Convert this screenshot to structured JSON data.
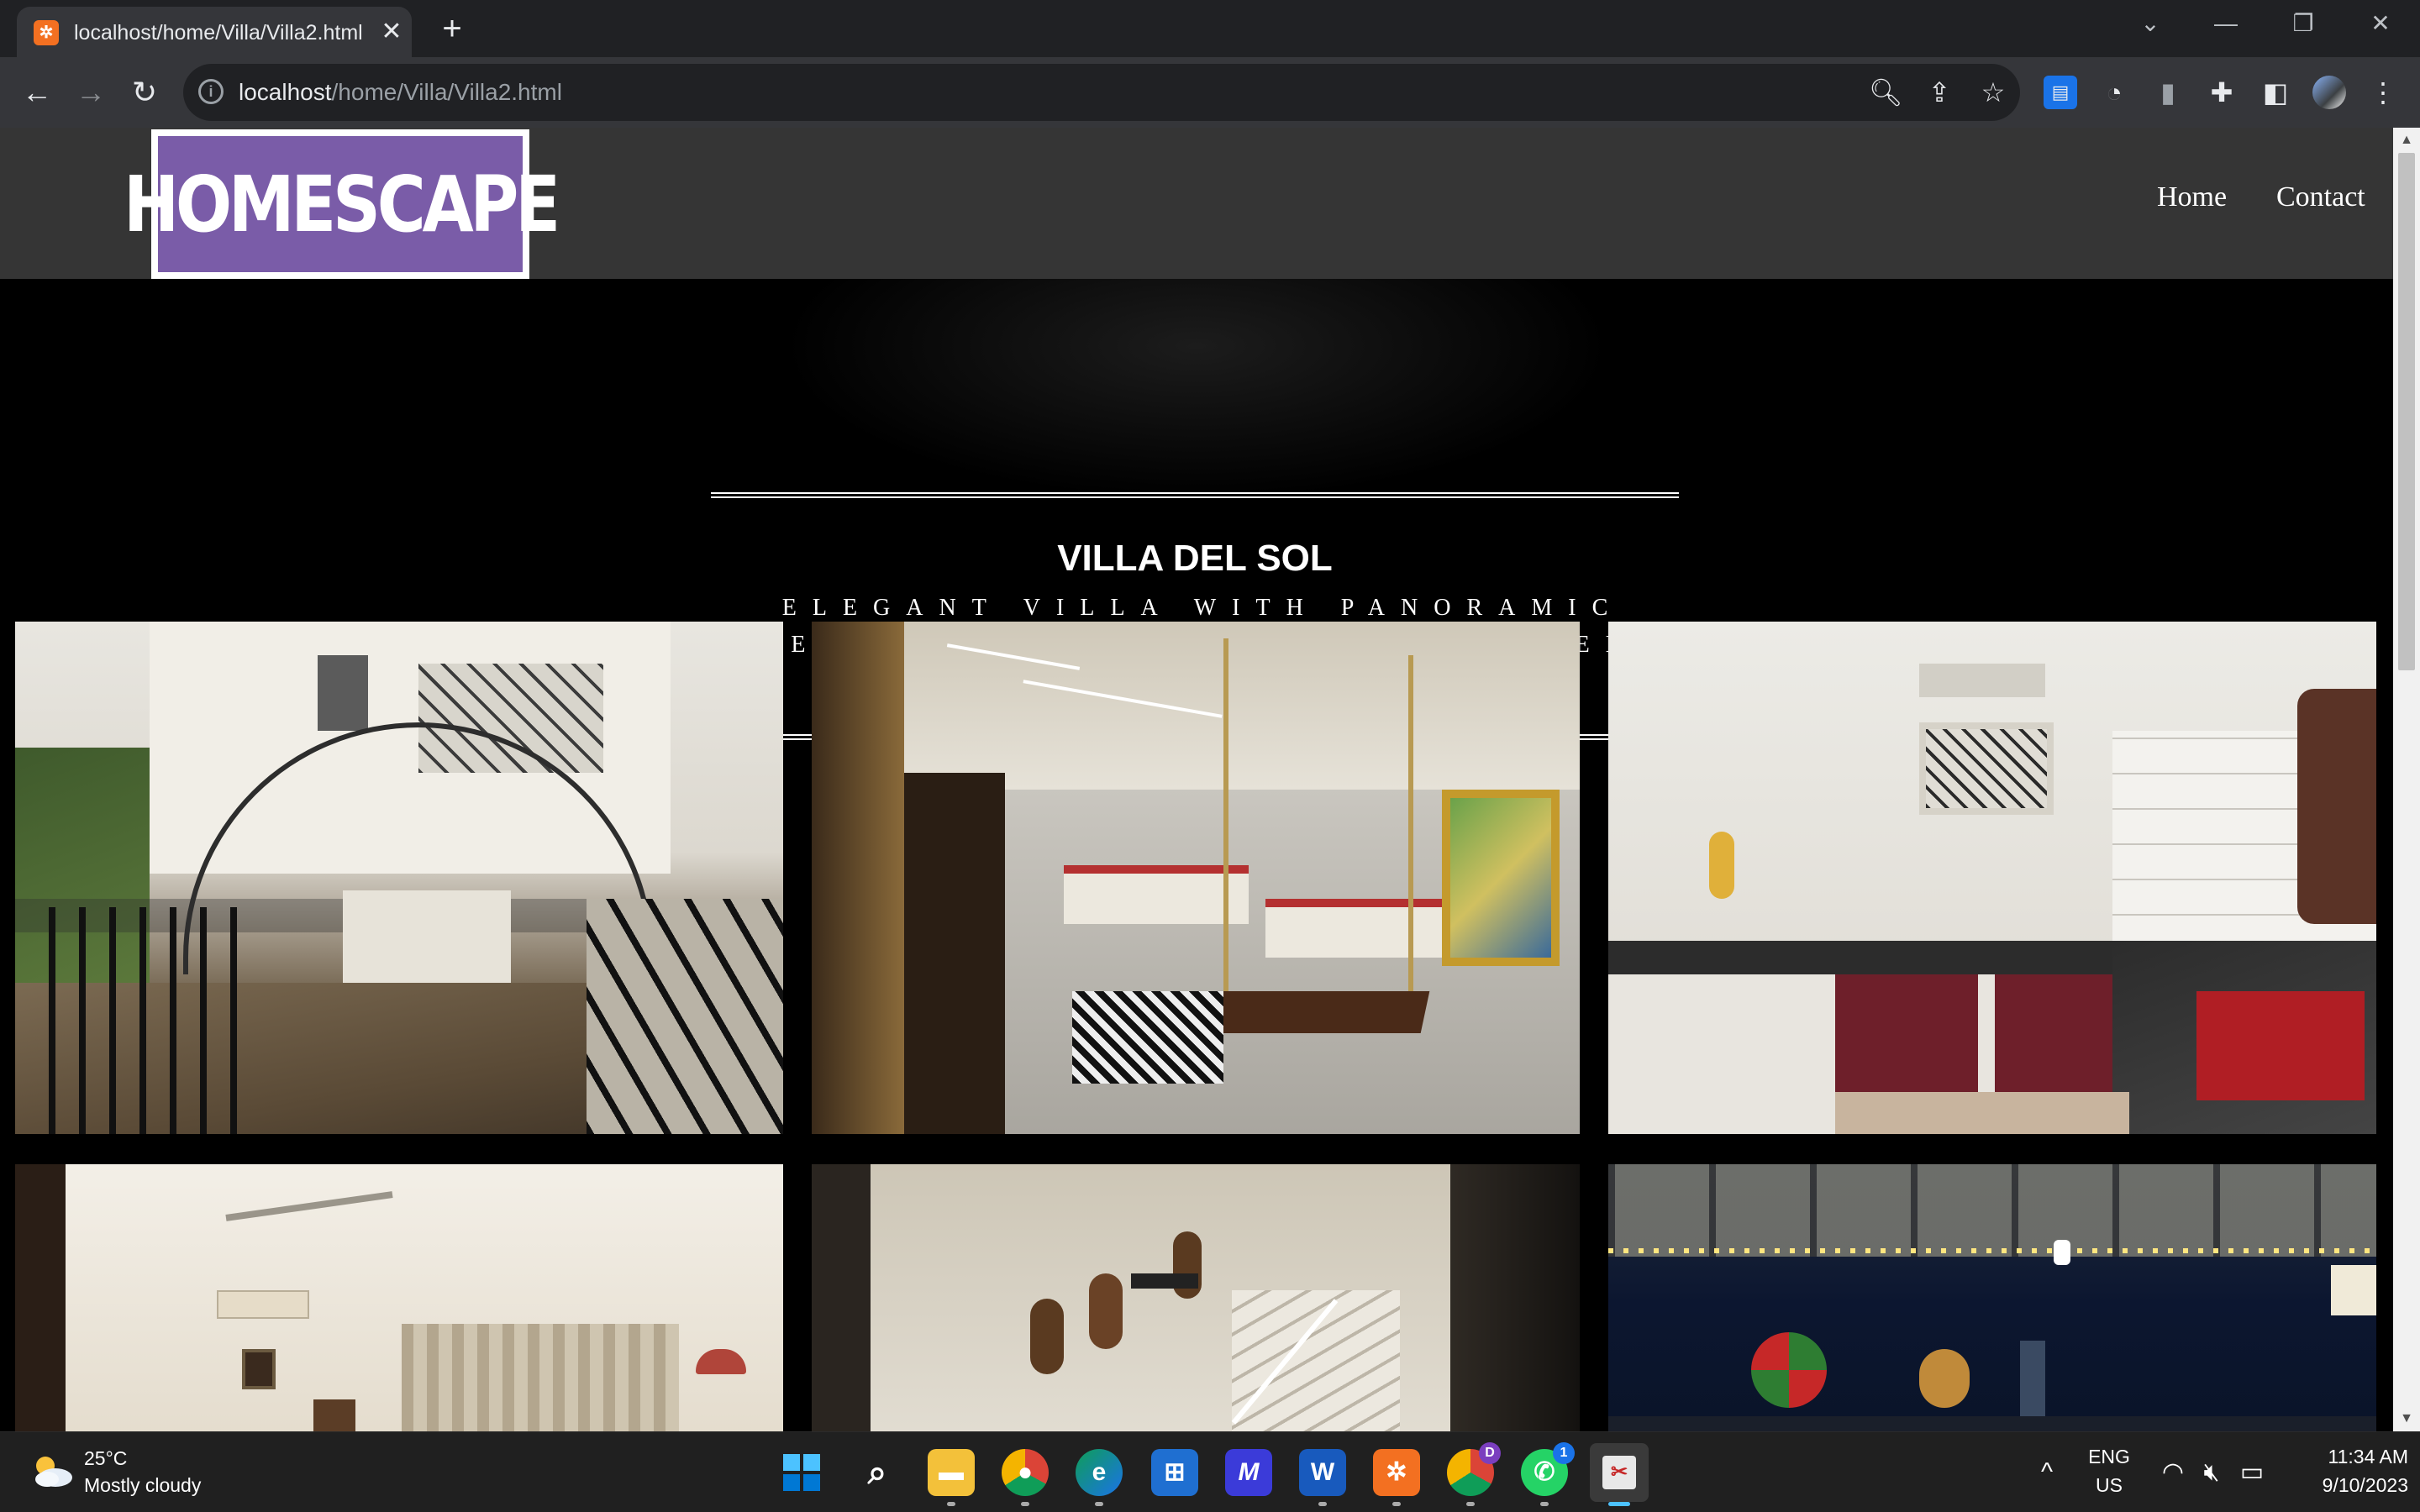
{
  "browser": {
    "tab_title": "localhost/home/Villa/Villa2.html",
    "url_host": "localhost",
    "url_path": "/home/Villa/Villa2.html"
  },
  "site": {
    "logo_text": "HOMESCAPE",
    "nav": [
      "Home",
      "Contact"
    ]
  },
  "hero": {
    "title": "VILLA DEL SOL",
    "subtitle": "ELEGANT VILLA WITH PANORAMIC VIEWS, PROVIDING A PERFECT BLEND OF LUXURY AND SERENITY."
  },
  "gallery": [
    {
      "name": "villa-exterior-photo"
    },
    {
      "name": "living-room-photo"
    },
    {
      "name": "kitchen-photo"
    },
    {
      "name": "bedroom-photo"
    },
    {
      "name": "staircase-photo"
    },
    {
      "name": "terrace-photo"
    }
  ],
  "taskbar": {
    "weather_temp": "25°C",
    "weather_desc": "Mostly cloudy",
    "lang_line1": "ENG",
    "lang_line2": "US",
    "time": "11:34 AM",
    "date": "9/10/2023",
    "chrome_badge": "D",
    "whatsapp_badge": "1"
  },
  "colors": {
    "logo_purple": "#7a5ca8",
    "header_bg": "#353535",
    "page_bg": "#000000"
  }
}
